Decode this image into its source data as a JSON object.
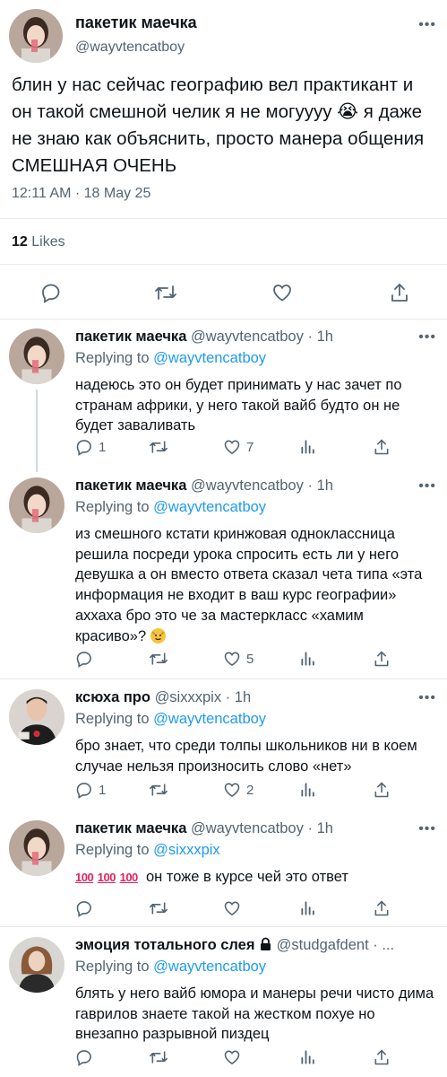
{
  "main_tweet": {
    "author_name": "пакетик маечка",
    "author_handle": "@wayvtencatboy",
    "text": "блин у нас сейчас географию вел практикант и он такой смешной челик я не могуууу 😭 я даже не знаю как объяснить, просто манера общения СМЕШНАЯ ОЧЕНЬ",
    "timestamp": "12:11 AM · 18 May 25",
    "likes_count": "12",
    "likes_label": "Likes"
  },
  "icons": {
    "reply": "reply-icon",
    "retweet": "retweet-icon",
    "like": "heart-icon",
    "views": "analytics-icon",
    "share": "share-icon",
    "more": "more-dots-icon",
    "lock": "lock-icon"
  },
  "colors": {
    "link": "#1d9bf0",
    "secondary_text": "#536471",
    "divider": "#e7e9ea",
    "thread_line": "#cfd9de"
  },
  "replies": [
    {
      "author_name": "пакетик маечка",
      "author_handle": "@wayvtencatboy",
      "age": "1h",
      "replying_label": "Replying to",
      "replying_to": "@wayvtencatboy",
      "text": "надеюсь это он будет принимать у нас зачет по странам африки, у него такой вайб будто он не будет заваливать",
      "reply_count": "1",
      "retweet_count": "",
      "like_count": "7"
    },
    {
      "author_name": "пакетик маечка",
      "author_handle": "@wayvtencatboy",
      "age": "1h",
      "replying_label": "Replying to",
      "replying_to": "@wayvtencatboy",
      "text": "из смешного кстати кринжовая одноклассница решила посреди урока спросить есть ли у него девушка а он вместо ответа сказал чета типа «эта информация не входит в ваш курс географии» аххаха бро это че за мастеркласс «хамим красиво»?",
      "text_emoji": "smirking-cat-emoji",
      "reply_count": "",
      "retweet_count": "",
      "like_count": "5"
    },
    {
      "author_name": "ксюха про",
      "author_handle": "@sixxxpix",
      "age": "1h",
      "replying_label": "Replying to",
      "replying_to": "@wayvtencatboy",
      "text": "бро знает, что среди толпы школьников ни в коем случае нельзя произносить слово «нет»",
      "reply_count": "1",
      "retweet_count": "",
      "like_count": "2"
    },
    {
      "author_name": "пакетик маечка",
      "author_handle": "@wayvtencatboy",
      "age": "1h",
      "replying_label": "Replying to",
      "replying_to": "@sixxxpix",
      "emoji_prefix": [
        "100",
        "100",
        "100"
      ],
      "text": "он тоже в курсе чей это ответ",
      "reply_count": "",
      "retweet_count": "",
      "like_count": ""
    },
    {
      "author_name": "эмоция тотального слея",
      "author_handle": "@studgafdent · ...",
      "age": "",
      "replying_label": "Replying to",
      "replying_to": "@wayvtencatboy",
      "text": "блять у него вайб юмора и манеры речи чисто дима гаврилов знаете такой на жестком похуе но внезапно разрывной пиздец",
      "reply_count": "",
      "retweet_count": "",
      "like_count": ""
    }
  ]
}
